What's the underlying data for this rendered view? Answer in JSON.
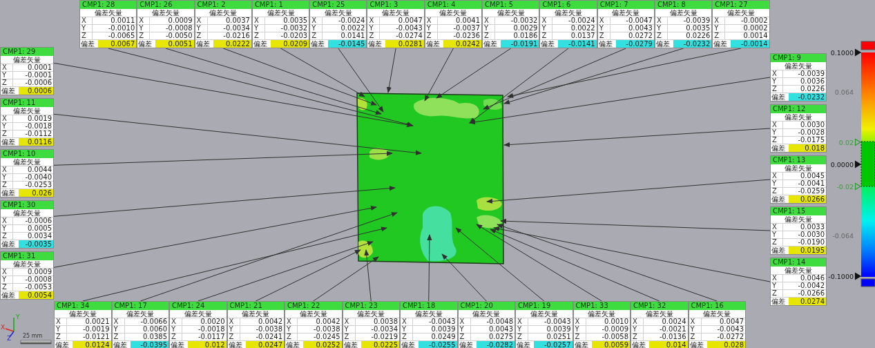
{
  "callouts_top": [
    {
      "id": "CMP1: 28",
      "title": "偏差矢量",
      "rows": [
        {
          "axis": "X",
          "value": "0.0011"
        },
        {
          "axis": "Y",
          "value": "-0.0010"
        },
        {
          "axis": "Z",
          "value": "-0.0065"
        }
      ],
      "deviation": {
        "label": "偏差",
        "value": "0.0067",
        "color": "#e6e600"
      }
    },
    {
      "id": "CMP1: 26",
      "title": "偏差矢量",
      "rows": [
        {
          "axis": "X",
          "value": "0.0009"
        },
        {
          "axis": "Y",
          "value": "-0.0008"
        },
        {
          "axis": "Z",
          "value": "-0.0050"
        }
      ],
      "deviation": {
        "label": "偏差",
        "value": "0.0051",
        "color": "#e6e600"
      }
    },
    {
      "id": "CMP1: 2",
      "title": "偏差矢量",
      "rows": [
        {
          "axis": "X",
          "value": "0.0037"
        },
        {
          "axis": "Y",
          "value": "-0.0034"
        },
        {
          "axis": "Z",
          "value": "-0.0216"
        }
      ],
      "deviation": {
        "label": "偏差",
        "value": "0.0222",
        "color": "#e6e600"
      }
    },
    {
      "id": "CMP1: 1",
      "title": "偏差矢量",
      "rows": [
        {
          "axis": "X",
          "value": "0.0035"
        },
        {
          "axis": "Y",
          "value": "-0.0032"
        },
        {
          "axis": "Z",
          "value": "-0.0203"
        }
      ],
      "deviation": {
        "label": "偏差",
        "value": "0.0209",
        "color": "#e6e600"
      }
    },
    {
      "id": "CMP1: 25",
      "title": "偏差矢量",
      "rows": [
        {
          "axis": "X",
          "value": "-0.0024"
        },
        {
          "axis": "Y",
          "value": "0.0022"
        },
        {
          "axis": "Z",
          "value": "0.0141"
        }
      ],
      "deviation": {
        "label": "偏差",
        "value": "-0.0145",
        "color": "#33e0e0"
      }
    },
    {
      "id": "CMP1: 3",
      "title": "偏差矢量",
      "rows": [
        {
          "axis": "X",
          "value": "0.0047"
        },
        {
          "axis": "Y",
          "value": "-0.0043"
        },
        {
          "axis": "Z",
          "value": "-0.0274"
        }
      ],
      "deviation": {
        "label": "偏差",
        "value": "0.0281",
        "color": "#e6e600"
      }
    },
    {
      "id": "CMP1: 4",
      "title": "偏差矢量",
      "rows": [
        {
          "axis": "X",
          "value": "0.0041"
        },
        {
          "axis": "Y",
          "value": "-0.0037"
        },
        {
          "axis": "Z",
          "value": "-0.0236"
        }
      ],
      "deviation": {
        "label": "偏差",
        "value": "0.0242",
        "color": "#e6e600"
      }
    },
    {
      "id": "CMP1: 5",
      "title": "偏差矢量",
      "rows": [
        {
          "axis": "X",
          "value": "-0.0032"
        },
        {
          "axis": "Y",
          "value": "0.0029"
        },
        {
          "axis": "Z",
          "value": "0.0186"
        }
      ],
      "deviation": {
        "label": "偏差",
        "value": "-0.0191",
        "color": "#33e0e0"
      }
    },
    {
      "id": "CMP1: 6",
      "title": "偏差矢量",
      "rows": [
        {
          "axis": "X",
          "value": "-0.0024"
        },
        {
          "axis": "Y",
          "value": "0.0022"
        },
        {
          "axis": "Z",
          "value": "0.0137"
        }
      ],
      "deviation": {
        "label": "偏差",
        "value": "-0.0141",
        "color": "#33e0e0"
      }
    },
    {
      "id": "CMP1: 7",
      "title": "偏差矢量",
      "rows": [
        {
          "axis": "X",
          "value": "-0.0047"
        },
        {
          "axis": "Y",
          "value": "0.0043"
        },
        {
          "axis": "Z",
          "value": "0.0272"
        }
      ],
      "deviation": {
        "label": "偏差",
        "value": "-0.0279",
        "color": "#33e0e0"
      }
    },
    {
      "id": "CMP1: 8",
      "title": "偏差矢量",
      "rows": [
        {
          "axis": "X",
          "value": "-0.0039"
        },
        {
          "axis": "Y",
          "value": "0.0035"
        },
        {
          "axis": "Z",
          "value": "0.0226"
        }
      ],
      "deviation": {
        "label": "偏差",
        "value": "-0.0232",
        "color": "#33e0e0"
      }
    },
    {
      "id": "CMP1: 27",
      "title": "偏差矢量",
      "rows": [
        {
          "axis": "X",
          "value": "-0.0002"
        },
        {
          "axis": "Y",
          "value": "0.0002"
        },
        {
          "axis": "Z",
          "value": "0.0014"
        }
      ],
      "deviation": {
        "label": "偏差",
        "value": "-0.0014",
        "color": "#33e0e0"
      }
    }
  ],
  "callouts_left": [
    {
      "id": "CMP1: 29",
      "title": "偏差矢量",
      "rows": [
        {
          "axis": "X",
          "value": "0.0001"
        },
        {
          "axis": "Y",
          "value": "-0.0001"
        },
        {
          "axis": "Z",
          "value": "-0.0006"
        }
      ],
      "deviation": {
        "label": "偏差",
        "value": "0.0006",
        "color": "#e6e600"
      }
    },
    {
      "id": "CMP1: 11",
      "title": "偏差矢量",
      "rows": [
        {
          "axis": "X",
          "value": "0.0019"
        },
        {
          "axis": "Y",
          "value": "-0.0018"
        },
        {
          "axis": "Z",
          "value": "-0.0112"
        }
      ],
      "deviation": {
        "label": "偏差",
        "value": "0.0116",
        "color": "#e6e600"
      }
    },
    {
      "id": "CMP1: 10",
      "title": "偏差矢量",
      "rows": [
        {
          "axis": "X",
          "value": "0.0044"
        },
        {
          "axis": "Y",
          "value": "-0.0040"
        },
        {
          "axis": "Z",
          "value": "-0.0253"
        }
      ],
      "deviation": {
        "label": "偏差",
        "value": "0.026",
        "color": "#e6e600"
      }
    },
    {
      "id": "CMP1: 30",
      "title": "偏差矢量",
      "rows": [
        {
          "axis": "X",
          "value": "-0.0006"
        },
        {
          "axis": "Y",
          "value": "0.0005"
        },
        {
          "axis": "Z",
          "value": "0.0034"
        }
      ],
      "deviation": {
        "label": "偏差",
        "value": "-0.0035",
        "color": "#33e0e0"
      }
    },
    {
      "id": "CMP1: 31",
      "title": "偏差矢量",
      "rows": [
        {
          "axis": "X",
          "value": "0.0009"
        },
        {
          "axis": "Y",
          "value": "-0.0008"
        },
        {
          "axis": "Z",
          "value": "-0.0053"
        }
      ],
      "deviation": {
        "label": "偏差",
        "value": "0.0054",
        "color": "#e6e600"
      }
    }
  ],
  "callouts_right": [
    {
      "id": "CMP1: 9",
      "title": "偏差矢量",
      "rows": [
        {
          "axis": "X",
          "value": "-0.0039"
        },
        {
          "axis": "Y",
          "value": "0.0036"
        },
        {
          "axis": "Z",
          "value": "0.0226"
        }
      ],
      "deviation": {
        "label": "偏差",
        "value": "-0.0232",
        "color": "#33e0e0"
      }
    },
    {
      "id": "CMP1: 12",
      "title": "偏差矢量",
      "rows": [
        {
          "axis": "X",
          "value": "0.0030"
        },
        {
          "axis": "Y",
          "value": "-0.0028"
        },
        {
          "axis": "Z",
          "value": "-0.0175"
        }
      ],
      "deviation": {
        "label": "偏差",
        "value": "0.018",
        "color": "#e6e600"
      }
    },
    {
      "id": "CMP1: 13",
      "title": "偏差矢量",
      "rows": [
        {
          "axis": "X",
          "value": "0.0045"
        },
        {
          "axis": "Y",
          "value": "-0.0041"
        },
        {
          "axis": "Z",
          "value": "-0.0259"
        }
      ],
      "deviation": {
        "label": "偏差",
        "value": "0.0266",
        "color": "#e6e600"
      }
    },
    {
      "id": "CMP1: 15",
      "title": "偏差矢量",
      "rows": [
        {
          "axis": "X",
          "value": "0.0033"
        },
        {
          "axis": "Y",
          "value": "-0.0030"
        },
        {
          "axis": "Z",
          "value": "-0.0190"
        }
      ],
      "deviation": {
        "label": "偏差",
        "value": "0.0195",
        "color": "#e6e600"
      }
    },
    {
      "id": "CMP1: 14",
      "title": "偏差矢量",
      "rows": [
        {
          "axis": "X",
          "value": "0.0046"
        },
        {
          "axis": "Y",
          "value": "-0.0042"
        },
        {
          "axis": "Z",
          "value": "-0.0266"
        }
      ],
      "deviation": {
        "label": "偏差",
        "value": "0.0274",
        "color": "#e6e600"
      }
    }
  ],
  "callouts_bottom": [
    {
      "id": "CMP1: 34",
      "title": "偏差矢量",
      "rows": [
        {
          "axis": "X",
          "value": "0.0021"
        },
        {
          "axis": "Y",
          "value": "-0.0019"
        },
        {
          "axis": "Z",
          "value": "-0.0121"
        }
      ],
      "deviation": {
        "label": "偏差",
        "value": "0.0124",
        "color": "#e6e600"
      }
    },
    {
      "id": "CMP1: 17",
      "title": "偏差矢量",
      "rows": [
        {
          "axis": "X",
          "value": "-0.0066"
        },
        {
          "axis": "Y",
          "value": "0.0060"
        },
        {
          "axis": "Z",
          "value": "0.0385"
        }
      ],
      "deviation": {
        "label": "偏差",
        "value": "-0.0395",
        "color": "#33e0e0"
      }
    },
    {
      "id": "CMP1: 24",
      "title": "偏差矢量",
      "rows": [
        {
          "axis": "X",
          "value": "0.0020"
        },
        {
          "axis": "Y",
          "value": "-0.0018"
        },
        {
          "axis": "Z",
          "value": "-0.0117"
        }
      ],
      "deviation": {
        "label": "偏差",
        "value": "0.012",
        "color": "#e6e600"
      }
    },
    {
      "id": "CMP1: 21",
      "title": "偏差矢量",
      "rows": [
        {
          "axis": "X",
          "value": "0.0042"
        },
        {
          "axis": "Y",
          "value": "-0.0038"
        },
        {
          "axis": "Z",
          "value": "-0.0241"
        }
      ],
      "deviation": {
        "label": "偏差",
        "value": "0.0247",
        "color": "#e6e600"
      }
    },
    {
      "id": "CMP1: 22",
      "title": "偏差矢量",
      "rows": [
        {
          "axis": "X",
          "value": "0.0042"
        },
        {
          "axis": "Y",
          "value": "-0.0038"
        },
        {
          "axis": "Z",
          "value": "-0.0245"
        }
      ],
      "deviation": {
        "label": "偏差",
        "value": "0.0252",
        "color": "#e6e600"
      }
    },
    {
      "id": "CMP1: 23",
      "title": "偏差矢量",
      "rows": [
        {
          "axis": "X",
          "value": "0.0038"
        },
        {
          "axis": "Y",
          "value": "-0.0034"
        },
        {
          "axis": "Z",
          "value": "-0.0219"
        }
      ],
      "deviation": {
        "label": "偏差",
        "value": "0.0225",
        "color": "#e6e600"
      }
    },
    {
      "id": "CMP1: 18",
      "title": "偏差矢量",
      "rows": [
        {
          "axis": "X",
          "value": "-0.0043"
        },
        {
          "axis": "Y",
          "value": "0.0039"
        },
        {
          "axis": "Z",
          "value": "0.0249"
        }
      ],
      "deviation": {
        "label": "偏差",
        "value": "-0.0255",
        "color": "#33e0e0"
      }
    },
    {
      "id": "CMP1: 20",
      "title": "偏差矢量",
      "rows": [
        {
          "axis": "X",
          "value": "-0.0048"
        },
        {
          "axis": "Y",
          "value": "0.0043"
        },
        {
          "axis": "Z",
          "value": "0.0275"
        }
      ],
      "deviation": {
        "label": "偏差",
        "value": "-0.0282",
        "color": "#33e0e0"
      }
    },
    {
      "id": "CMP1: 19",
      "title": "偏差矢量",
      "rows": [
        {
          "axis": "X",
          "value": "-0.0043"
        },
        {
          "axis": "Y",
          "value": "0.0039"
        },
        {
          "axis": "Z",
          "value": "0.0251"
        }
      ],
      "deviation": {
        "label": "偏差",
        "value": "-0.0257",
        "color": "#33e0e0"
      }
    },
    {
      "id": "CMP1: 33",
      "title": "偏差矢量",
      "rows": [
        {
          "axis": "X",
          "value": "0.0010"
        },
        {
          "axis": "Y",
          "value": "-0.0009"
        },
        {
          "axis": "Z",
          "value": "-0.0058"
        }
      ],
      "deviation": {
        "label": "偏差",
        "value": "0.0059",
        "color": "#e6e600"
      }
    },
    {
      "id": "CMP1: 32",
      "title": "偏差矢量",
      "rows": [
        {
          "axis": "X",
          "value": "0.0024"
        },
        {
          "axis": "Y",
          "value": "-0.0021"
        },
        {
          "axis": "Z",
          "value": "-0.0136"
        }
      ],
      "deviation": {
        "label": "偏差",
        "value": "0.014",
        "color": "#e6e600"
      }
    },
    {
      "id": "CMP1: 16",
      "title": "偏差矢量",
      "rows": [
        {
          "axis": "X",
          "value": "0.0047"
        },
        {
          "axis": "Y",
          "value": "-0.0043"
        },
        {
          "axis": "Z",
          "value": "-0.0272"
        }
      ],
      "deviation": {
        "label": "偏差",
        "value": "0.028",
        "color": "#e6e600"
      }
    }
  ],
  "color_scale": {
    "labels": [
      {
        "text": "0.1000",
        "kind": "limit"
      },
      {
        "text": "0.064",
        "kind": "tick"
      },
      {
        "text": "0.02",
        "kind": "tolerance"
      },
      {
        "text": "0.0000",
        "kind": "nominal"
      },
      {
        "text": "-0.02",
        "kind": "tolerance"
      },
      {
        "text": "-0.064",
        "kind": "tick"
      },
      {
        "text": "-0.1000",
        "kind": "limit"
      }
    ]
  },
  "triad": {
    "labels": [
      "X",
      "Y",
      "Z"
    ]
  },
  "scale_bar": {
    "label": "25 mm"
  }
}
